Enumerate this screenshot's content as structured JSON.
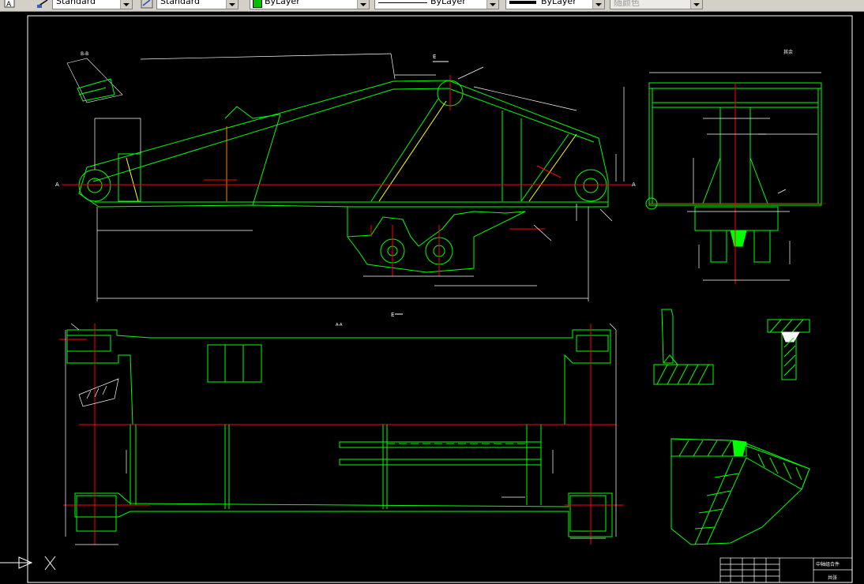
{
  "toolbar": {
    "text_style": "Standard",
    "dim_style": "Standard",
    "layer": "ByLayer",
    "linetype": "ByLayer",
    "lineweight": "ByLayer",
    "plotstyle": "随颜色"
  },
  "drawing": {
    "section_bb": "B-B",
    "section_e_top": "E",
    "section_e_bottom": "E",
    "section_aa": "A-A",
    "marker_a_left": "A",
    "marker_a_right": "A",
    "detail_roughness": "其余",
    "ucs_x": "X",
    "title_block_name": "中轴组合件",
    "title_block_note": "共张"
  },
  "colors": {
    "outline": "#00ff00",
    "centerline": "#ff0000",
    "dimension": "#ffffff",
    "hatch": "#00ff00",
    "weld_fill": "#00ff00",
    "border": "#ffffff"
  }
}
